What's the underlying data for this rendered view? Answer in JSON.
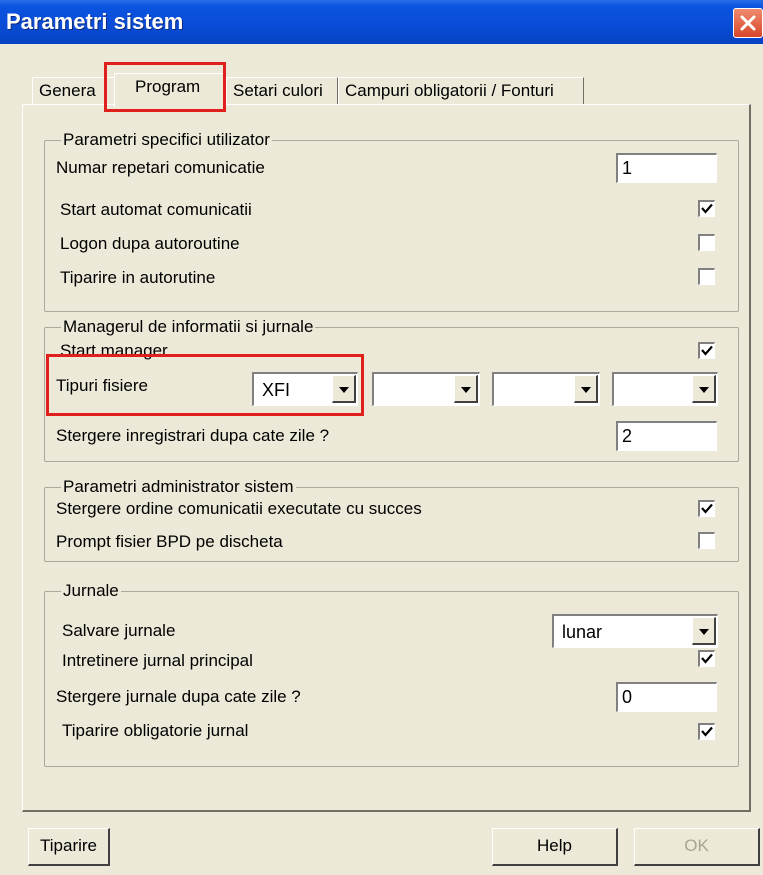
{
  "window": {
    "title": "Parametri sistem"
  },
  "tabs": [
    {
      "label": "Genera"
    },
    {
      "label": "Program"
    },
    {
      "label": "Setari culori"
    },
    {
      "label": "Campuri obligatorii / Fonturi"
    }
  ],
  "groups": {
    "user": {
      "legend": "Parametri specifici utilizator",
      "repetari_label": "Numar repetari comunicatie",
      "repetari_value": "1",
      "start_auto_label": "Start automat comunicatii",
      "logon_label": "Logon dupa autoroutine",
      "tiparire_auto_label": "Tiparire in autorutine"
    },
    "manager": {
      "legend": "Managerul de informatii si jurnale",
      "start_manager_label": "Start manager",
      "tipuri_label": "Tipuri fisiere",
      "tipuri_values": [
        "XFI",
        "",
        "",
        ""
      ],
      "stergere_label": "Stergere inregistrari dupa cate zile ?",
      "stergere_value": "2"
    },
    "admin": {
      "legend": "Parametri administrator sistem",
      "stergere_ordine_label": "Stergere ordine comunicatii executate cu succes",
      "prompt_label": "Prompt fisier BPD pe discheta"
    },
    "jurnale": {
      "legend": "Jurnale",
      "salvare_label": "Salvare jurnale",
      "salvare_value": "lunar",
      "intretinere_label": "Intretinere jurnal principal",
      "stergere_label": "Stergere jurnale dupa cate zile ?",
      "stergere_value": "0",
      "tiparire_label": "Tiparire obligatorie jurnal"
    }
  },
  "checkboxes": {
    "start_auto": true,
    "logon": false,
    "tiparire_auto": false,
    "start_manager": true,
    "stergere_ordine": true,
    "prompt": false,
    "intretinere": true,
    "tiparire_jurnal": true
  },
  "buttons": {
    "print": "Tiparire",
    "help": "Help",
    "ok": "OK"
  },
  "colors": {
    "title_bar": "#0a4cd6",
    "highlight": "#e0201c",
    "dialog_bg": "#ece9d8"
  }
}
